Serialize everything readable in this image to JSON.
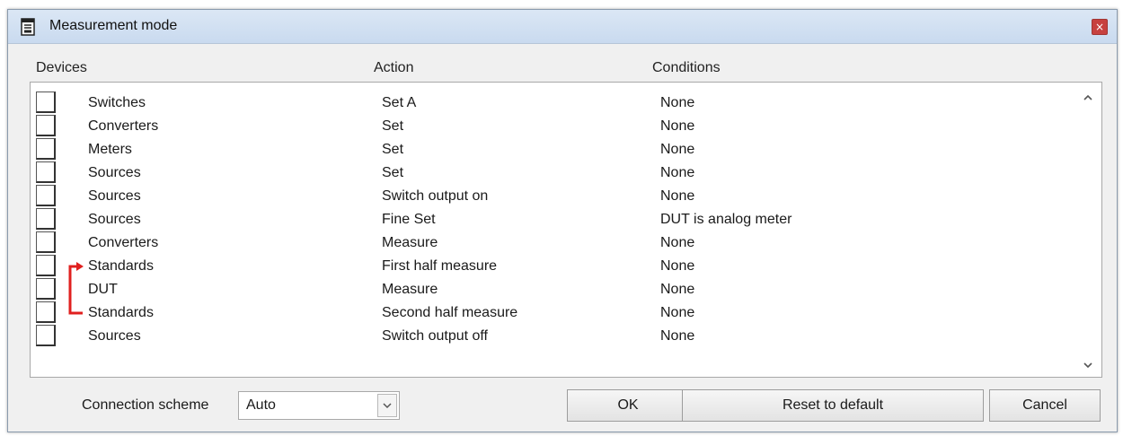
{
  "window": {
    "title": "Measurement mode",
    "close_label": "×",
    "icon": "table-icon"
  },
  "columns": {
    "devices": "Devices",
    "action": "Action",
    "conditions": "Conditions"
  },
  "rows": [
    {
      "device": "Switches",
      "action": "Set A",
      "condition": "None",
      "checked": false
    },
    {
      "device": "Converters",
      "action": "Set",
      "condition": "None",
      "checked": false
    },
    {
      "device": "Meters",
      "action": "Set",
      "condition": "None",
      "checked": false
    },
    {
      "device": "Sources",
      "action": "Set",
      "condition": "None",
      "checked": false
    },
    {
      "device": "Sources",
      "action": "Switch output on",
      "condition": "None",
      "checked": false
    },
    {
      "device": "Sources",
      "action": "Fine Set",
      "condition": "DUT is analog meter",
      "checked": false
    },
    {
      "device": "Converters",
      "action": "Measure",
      "condition": "None",
      "checked": false
    },
    {
      "device": "Standards",
      "action": "First half measure",
      "condition": "None",
      "checked": false
    },
    {
      "device": "DUT",
      "action": "Measure",
      "condition": "None",
      "checked": false
    },
    {
      "device": "Standards",
      "action": "Second half measure",
      "condition": "None",
      "checked": false
    },
    {
      "device": "Sources",
      "action": "Switch output off",
      "condition": "None",
      "checked": false
    }
  ],
  "loop_arrow": {
    "from_row": 9,
    "to_row": 7,
    "color": "#e0201f",
    "icon": "loop-arrow-icon"
  },
  "footer": {
    "connection_label": "Connection scheme",
    "connection_value": "Auto",
    "ok_label": "OK",
    "reset_label": "Reset to default",
    "cancel_label": "Cancel"
  },
  "colors": {
    "titlebar": "#c9daef",
    "close_button": "#c7413f",
    "background": "#f0f0f0"
  }
}
